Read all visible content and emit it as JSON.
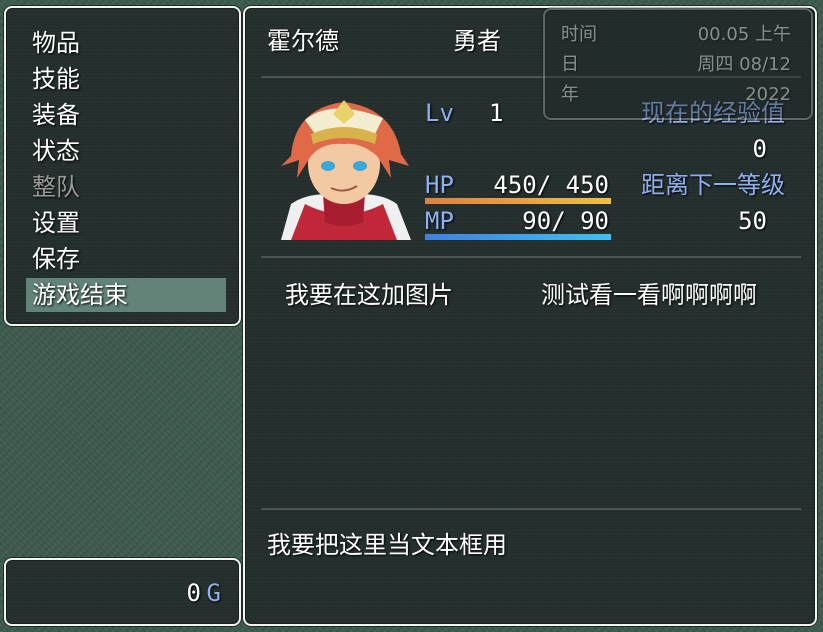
{
  "menu": {
    "items": [
      {
        "label": "物品",
        "enabled": true
      },
      {
        "label": "技能",
        "enabled": true
      },
      {
        "label": "装备",
        "enabled": true
      },
      {
        "label": "状态",
        "enabled": true
      },
      {
        "label": "整队",
        "enabled": false
      },
      {
        "label": "设置",
        "enabled": true
      },
      {
        "label": "保存",
        "enabled": true
      },
      {
        "label": "游戏结束",
        "enabled": true,
        "selected": true
      }
    ]
  },
  "gold": {
    "amount": "0",
    "unit": "G"
  },
  "time_window": {
    "time_label": "时间",
    "time_value": "00.05 上午",
    "day_label": "日",
    "day_value": "周四 08/12",
    "year_label": "年",
    "year_value": "2022"
  },
  "actor": {
    "name": "霍尔德",
    "class": "勇者",
    "lv_label": "Lv",
    "level": "1",
    "hp_label": "HP",
    "hp_text": "450/ 450",
    "hp_fraction": 1.0,
    "mp_label": "MP",
    "mp_text": "90/  90",
    "mp_fraction": 1.0,
    "exp_current_label": "现在的经验值",
    "exp_current": "0",
    "exp_next_label": "距离下一等级",
    "exp_next": "50"
  },
  "custom": {
    "image_text": "我要在这加图片",
    "test_text": "测试看一看啊啊啊啊",
    "textbox_text": "我要把这里当文本框用"
  },
  "colors": {
    "hp_gauge_start": "#e08040",
    "hp_gauge_end": "#f0c040",
    "mp_gauge_start": "#4080e0",
    "mp_gauge_end": "#40c0f0",
    "system_text": "#8fb0f0"
  }
}
